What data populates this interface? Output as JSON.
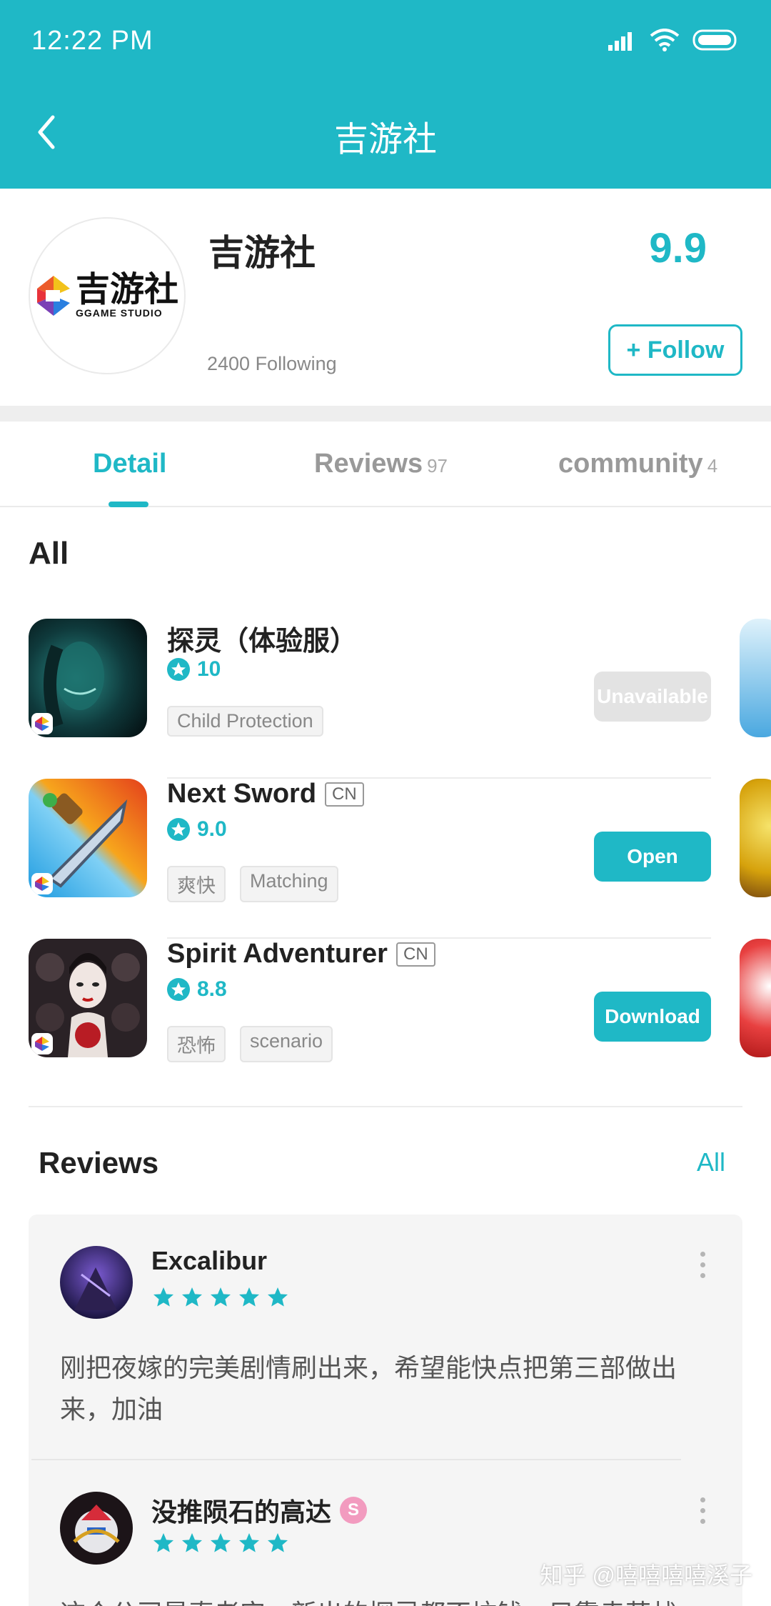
{
  "status_bar": {
    "time": "12:22  PM"
  },
  "header": {
    "title": "吉游社"
  },
  "profile": {
    "name": "吉游社",
    "logo_text": "吉游社",
    "logo_sub": "GGAME STUDIO",
    "following": "2400 Following",
    "score": "9.9",
    "follow_label": "+ Follow"
  },
  "tabs": [
    {
      "label": "Detail",
      "count": ""
    },
    {
      "label": "Reviews",
      "count": "97"
    },
    {
      "label": "community",
      "count": "4"
    }
  ],
  "games_section": {
    "title": "All"
  },
  "games": [
    {
      "name": "探灵（体验服）",
      "region": "",
      "rating": "10",
      "tags": [
        "Child Protection"
      ],
      "action": "Unavailable"
    },
    {
      "name": "Next Sword",
      "region": "CN",
      "rating": "9.0",
      "tags": [
        "爽快",
        "Matching"
      ],
      "action": "Open"
    },
    {
      "name": "Spirit Adventurer",
      "region": "CN",
      "rating": "8.8",
      "tags": [
        "恐怖",
        "scenario"
      ],
      "action": "Download"
    }
  ],
  "reviews": {
    "title": "Reviews",
    "all_link": "All",
    "items": [
      {
        "user": "Excalibur",
        "stars": 5,
        "text": "刚把夜嫁的完美剧情刷出来，希望能快点把第三部做出来，加油"
      },
      {
        "user": "没推陨石的高达",
        "badge": "S",
        "stars": 5,
        "text": "这个公司是真老实，新出的探灵都不坑钱，只靠卖萌战"
      }
    ]
  },
  "watermark": "知乎 @嘻嘻嘻嘻溪子",
  "colors": {
    "accent": "#1fb8c6",
    "header_bg": "#1fb8c6"
  }
}
